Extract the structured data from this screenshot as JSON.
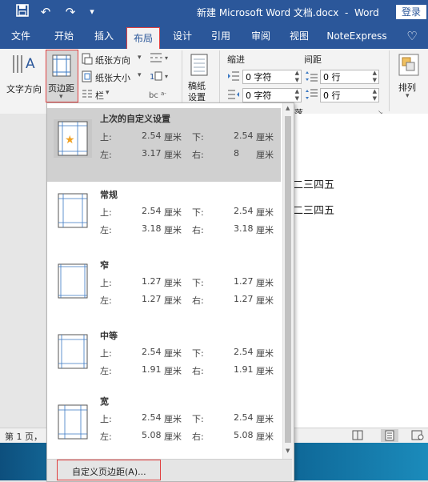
{
  "titlebar": {
    "save_icon": "save-icon",
    "undo_icon": "undo-icon",
    "redo_icon": "redo-icon",
    "customize_icon": "qa-dropdown-icon",
    "title": "新建 Microsoft Word 文档.docx  -  Word",
    "login": "登录"
  },
  "tabs": [
    "文件",
    "开始",
    "插入",
    "布局",
    "设计",
    "引用",
    "审阅",
    "视图",
    "NoteExpress"
  ],
  "active_tab": "布局",
  "ribbon": {
    "text_direction": "文字方向",
    "margins": "页边距",
    "orientation": "纸张方向",
    "size": "纸张大小",
    "columns": "栏",
    "draft": "稿纸\n设置",
    "indent_label": "缩进",
    "spacing_label": "间距",
    "indent_left": "0 字符",
    "indent_right": "0 字符",
    "spacing_before": "0 行",
    "spacing_after": "0 行",
    "paragraph_group": "落",
    "arrange": "排列"
  },
  "document": {
    "line1": "二三四五",
    "line2": "二三四五"
  },
  "margins_menu": {
    "unit": "厘米",
    "labels": {
      "top": "上:",
      "bottom": "下:",
      "left": "左:",
      "right": "右:"
    },
    "options": [
      {
        "name": "上次的自定义设置",
        "top": "2.54",
        "bottom": "2.54",
        "left": "3.17",
        "right": "8"
      },
      {
        "name": "常规",
        "top": "2.54",
        "bottom": "2.54",
        "left": "3.18",
        "right": "3.18"
      },
      {
        "name": "窄",
        "top": "1.27",
        "bottom": "1.27",
        "left": "1.27",
        "right": "1.27"
      },
      {
        "name": "中等",
        "top": "2.54",
        "bottom": "2.54",
        "left": "1.91",
        "right": "1.91"
      },
      {
        "name": "宽",
        "top": "2.54",
        "bottom": "2.54",
        "left": "5.08",
        "right": "5.08"
      }
    ],
    "custom": "自定义页边距(A)..."
  },
  "statusbar": {
    "page_info": "第 1 页，"
  }
}
